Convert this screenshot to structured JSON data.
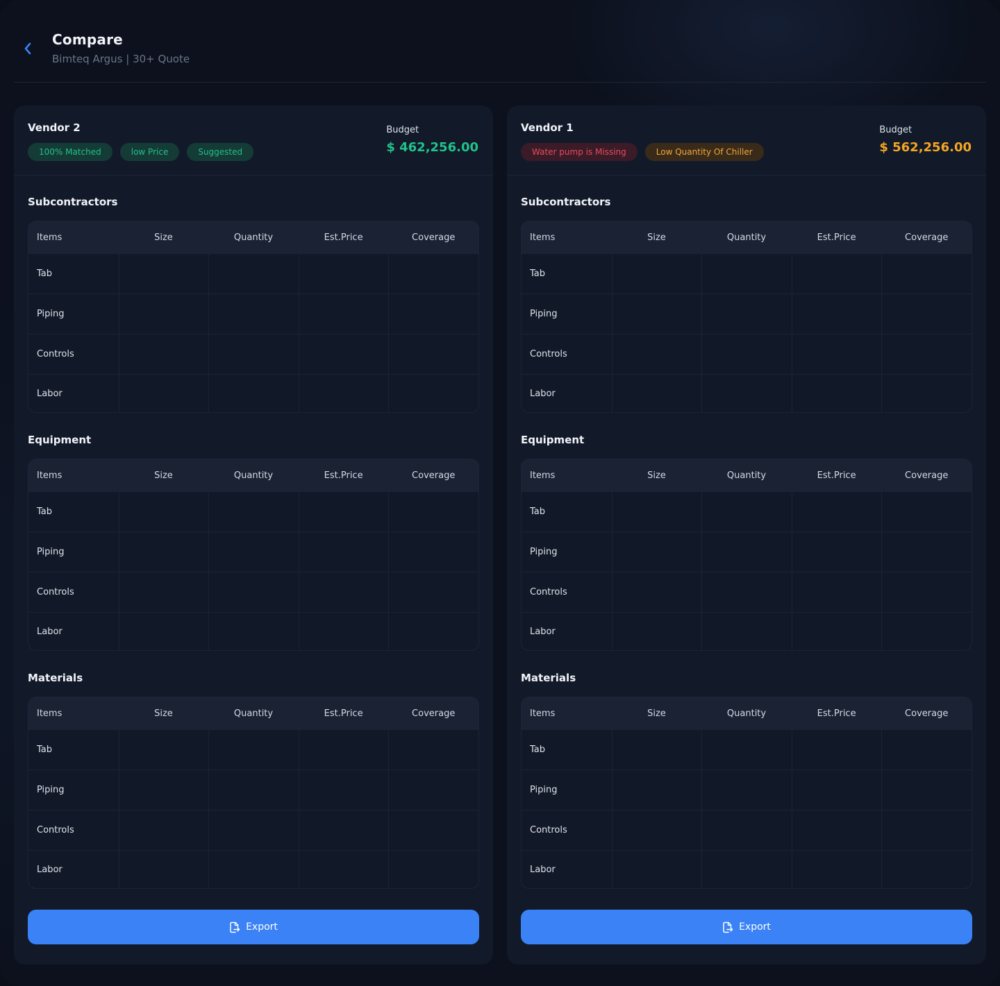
{
  "header": {
    "title": "Compare",
    "subtitle": "Bimteq Argus | 30+ Quote"
  },
  "colors": {
    "accent": "#3b82f6",
    "green": "#20c38a",
    "red": "#e84c5c",
    "orange": "#f5a623"
  },
  "vendors": [
    {
      "name": "Vendor 2",
      "tags": [
        {
          "label": "100% Matched",
          "tone": "green"
        },
        {
          "label": "low Price",
          "tone": "green"
        },
        {
          "label": "Suggested",
          "tone": "green"
        }
      ],
      "budget_label": "Budget",
      "budget_value": "$ 462,256.00",
      "budget_tone": "green",
      "export_label": "Export"
    },
    {
      "name": "Vendor 1",
      "tags": [
        {
          "label": "Water pump is Missing",
          "tone": "red"
        },
        {
          "label": "Low Quantity Of Chiller",
          "tone": "orange"
        }
      ],
      "budget_label": "Budget",
      "budget_value": "$ 562,256.00",
      "budget_tone": "orange",
      "export_label": "Export"
    }
  ],
  "sections": [
    {
      "title": "Subcontractors"
    },
    {
      "title": "Equipment"
    },
    {
      "title": "Materials"
    }
  ],
  "table": {
    "columns": [
      "Items",
      "Size",
      "Quantity",
      "Est.Price",
      "Coverage"
    ],
    "rows": [
      "Tab",
      "Piping",
      "Controls",
      "Labor"
    ]
  },
  "icons": {
    "back": "chevron-left-icon",
    "export": "file-export-icon"
  }
}
